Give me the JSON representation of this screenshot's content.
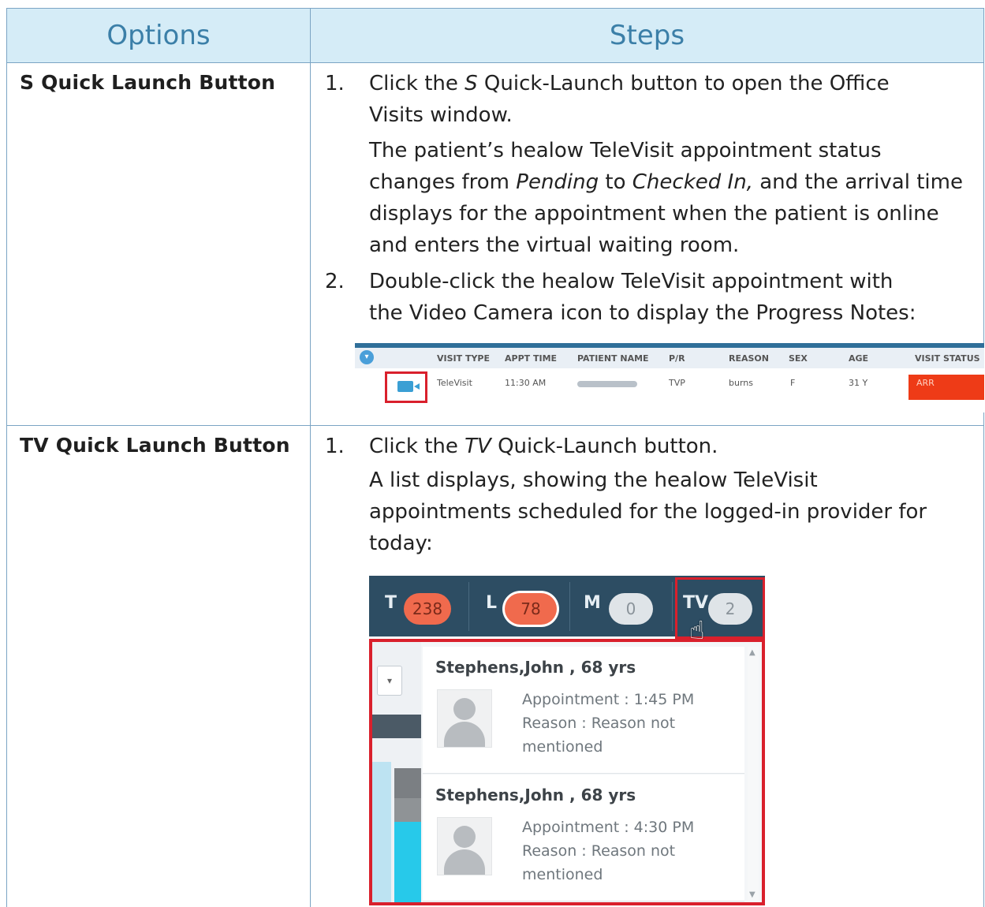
{
  "headers": {
    "options": "Options",
    "steps": "Steps"
  },
  "rows": [
    {
      "option": "S Quick Launch Button",
      "steps": {
        "s1_num": "1.",
        "s1_l1_a": "Click the ",
        "s1_l1_em": "S",
        "s1_l1_b": " Quick-Launch button to open the Office",
        "s1_l2": "Visits window.",
        "p1": "The patient’s healow TeleVisit appointment status",
        "p2_a": "changes from ",
        "p2_em1": "Pending",
        "p2_b": " to ",
        "p2_em2": "Checked In,",
        "p2_c": " and the arrival time",
        "p3": "displays for the appointment when the patient is online",
        "p4": "and enters the virtual waiting room.",
        "s2_num": "2.",
        "s2_l1": "Double-click the healow TeleVisit appointment with",
        "s2_l2": "the Video Camera icon to display the Progress Notes:"
      },
      "appointment_table": {
        "toggle_icon": "circle-toggle-icon",
        "columns": [
          "VISIT TYPE",
          "APPT TIME",
          "PATIENT NAME",
          "P/R",
          "REASON",
          "SEX",
          "AGE",
          "VISIT STATUS"
        ],
        "row": {
          "camera_icon": "video-camera-icon",
          "visit_type": "TeleVisit",
          "appt_time": "11:30 AM",
          "pr": "TVP",
          "reason": "burns",
          "sex": "F",
          "age": "31 Y",
          "visit_status": "ARR"
        }
      }
    },
    {
      "option": "TV Quick Launch Button",
      "steps": {
        "s1_num": "1.",
        "s1_l1_a": "Click the ",
        "s1_l1_em": "TV",
        "s1_l1_b": " Quick-Launch button.",
        "p1": "A list displays, showing the healow TeleVisit",
        "p2": "appointments scheduled for the logged-in provider for",
        "p3": "today:"
      },
      "quick_launch": {
        "buttons": [
          {
            "letter": "T",
            "count": "238"
          },
          {
            "letter": "L",
            "count": "78"
          },
          {
            "letter": "M",
            "count": "0"
          },
          {
            "letter": "TV",
            "count": "2"
          }
        ],
        "dropdown_icon": "chevron-down-icon",
        "appointments": [
          {
            "name": "Stephens,John , 68 yrs",
            "appointment": "Appointment : 1:45 PM",
            "reason_l1": "Reason : Reason not",
            "reason_l2": "mentioned"
          },
          {
            "name": "Stephens,John , 68 yrs",
            "appointment": "Appointment : 4:30 PM",
            "reason_l1": "Reason : Reason not",
            "reason_l2": "mentioned"
          }
        ]
      }
    }
  ],
  "colors": {
    "header_bg": "#d5ecf7",
    "header_text": "#3b7fa8",
    "highlight_red": "#d9202c",
    "status_orange": "#ee3b17"
  }
}
